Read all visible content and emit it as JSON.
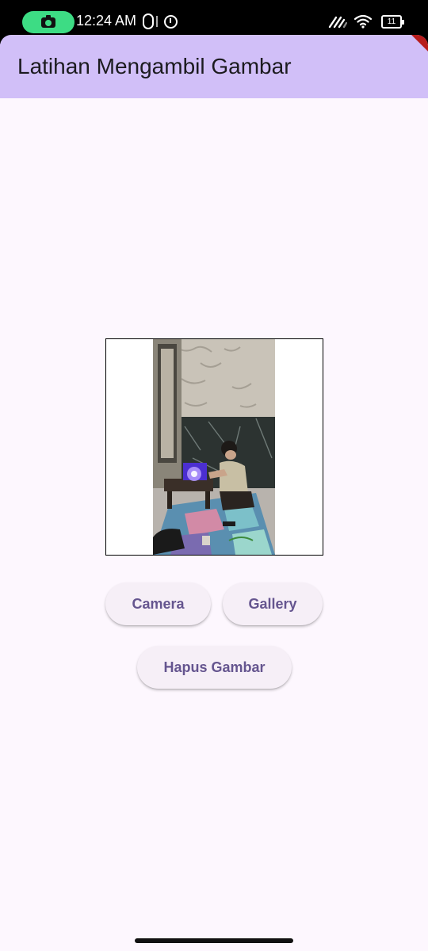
{
  "status_bar": {
    "time": "12:24 AM",
    "battery_level": "11",
    "icons": [
      "camera-icon",
      "notification-o-icon",
      "clock-icon",
      "signal-icon",
      "wifi-icon",
      "battery-icon"
    ]
  },
  "app_bar": {
    "title": "Latihan Mengambil Gambar",
    "background_color": "#d1bff8"
  },
  "image_preview": {
    "description_icon": "photo-preview"
  },
  "buttons": {
    "camera_label": "Camera",
    "gallery_label": "Gallery",
    "hapus_label": "Hapus Gambar",
    "text_color": "#65558f",
    "background_color": "#f6eff7"
  },
  "colors": {
    "page_background": "#fdf7fe",
    "status_pill": "#3ddc84"
  }
}
